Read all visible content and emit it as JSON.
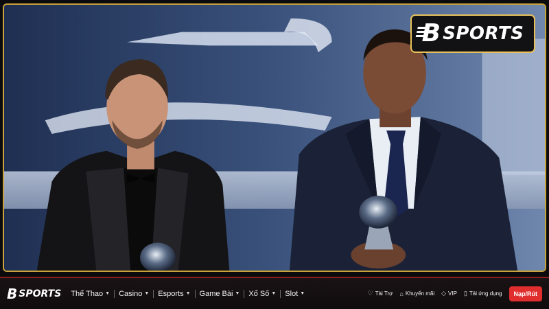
{
  "brand": {
    "logo_b": "B",
    "logo_word": "SPORTS"
  },
  "nav": {
    "logo_b": "B",
    "logo_word": "SPORTS",
    "menu": [
      {
        "label": "Thể Thao"
      },
      {
        "label": "Casino"
      },
      {
        "label": "Esports"
      },
      {
        "label": "Game Bài"
      },
      {
        "label": "Xổ Số"
      },
      {
        "label": "Slot"
      }
    ],
    "links": [
      {
        "label": "Tài Trợ",
        "icon": "sponsor-icon"
      },
      {
        "label": "Khuyến mãi",
        "icon": "tag-icon"
      },
      {
        "label": "VIP",
        "icon": "diamond-icon"
      },
      {
        "label": "Tải ứng dụng",
        "icon": "phone-icon"
      }
    ],
    "cta": "Nạp/Rút"
  },
  "colors": {
    "accent_red": "#e02e2e",
    "frame_gold": "#c9a23a",
    "nav_bg": "#141012"
  }
}
